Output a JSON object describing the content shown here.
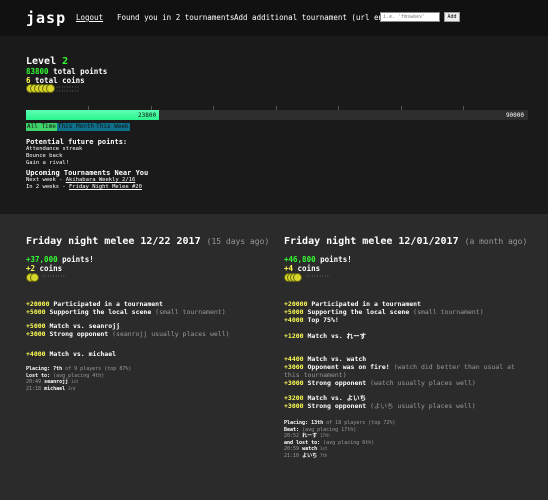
{
  "nav": {
    "logo": "jasp",
    "logout": "Logout",
    "found": "Found you in 2 tournaments",
    "add_label": "Add additional tournament (url ending)",
    "add_placeholder": "i.e. 'fmswkev'",
    "add_button": "Add"
  },
  "stats": {
    "level_label": "Level",
    "level_value": "2",
    "total_points": "83800 total points",
    "total_coins": "6 total coins",
    "coin_dots": ":::::::::\n:::::::::",
    "progress_current": "23800",
    "progress_max": "90000",
    "progress_fraction": 0.264,
    "tabs": [
      "All Time",
      "This Month",
      "This Week"
    ],
    "future_title": "Potential future points:",
    "future_items": [
      "Attendance streak",
      "Bounce back",
      "Gain a rival!"
    ],
    "upcoming_title": "Upcoming Tournaments Near You",
    "upcoming": [
      {
        "prefix": "Next week - ",
        "link": "Akihabara Weekly 2/16"
      },
      {
        "prefix": "In 2 weeks - ",
        "link": "Friday Night Melee #20"
      }
    ]
  },
  "tournaments": [
    {
      "title": "Friday night melee 12/22 2017",
      "ago": "(15 days ago)",
      "points": "+37,000 points!",
      "coins": "+2 coins",
      "coin_dots": ":::::::::",
      "groups": [
        [
          {
            "pts": "+20000",
            "desc": "Participated in a tournament",
            "note": ""
          },
          {
            "pts": "+5000",
            "desc": "Supporting the local scene",
            "note": "(small tournament)"
          }
        ],
        [
          {
            "pts": "+5000",
            "desc": "Match vs. seanrojj",
            "note": ""
          },
          {
            "pts": "+3000",
            "desc": "Strong opponent",
            "note": "(seanrojj usually places well)"
          }
        ],
        [
          {
            "pts": "+4000",
            "desc": "Match vs. michael",
            "note": ""
          }
        ]
      ],
      "placing": {
        "line1_bold": "Placing: 7th",
        "line1_rest": " of 9 players (top 87%)",
        "line2_bold": "Lost to:",
        "line2_rest": " (avg placing 4th)",
        "results": [
          {
            "score": "20:49",
            "name": "seanrojj",
            "tag": "1st"
          },
          {
            "score": "21:18",
            "name": "michael",
            "tag": "3rd"
          }
        ]
      }
    },
    {
      "title": "Friday night melee 12/01/2017",
      "ago": "(a month ago)",
      "points": "+46,800 points!",
      "coins": "+4 coins",
      "coin_dots": ":::::::::",
      "groups": [
        [
          {
            "pts": "+20000",
            "desc": "Participated in a tournament",
            "note": ""
          },
          {
            "pts": "+5000",
            "desc": "Supporting the local scene",
            "note": "(small tournament)"
          },
          {
            "pts": "+4000",
            "desc": "Top 75%!",
            "note": ""
          }
        ],
        [
          {
            "pts": "+1200",
            "desc": "Match vs. れーす",
            "note": ""
          }
        ],
        [
          {
            "pts": "+4400",
            "desc": "Match vs. watch",
            "note": ""
          },
          {
            "pts": "+3000",
            "desc": "Opponent was on fire!",
            "note": "(watch did better than usual at this tournament)"
          },
          {
            "pts": "+3000",
            "desc": "Strong opponent",
            "note": "(watch usually places well)"
          }
        ],
        [
          {
            "pts": "+3200",
            "desc": "Match vs. よいち",
            "note": ""
          },
          {
            "pts": "+3000",
            "desc": "Strong opponent",
            "note": "(よいち usually places well)"
          }
        ]
      ],
      "placing": {
        "line1_bold": "Placing: 13th",
        "line1_rest": " of 18 players (top 72%)",
        "line2_bold": "Beat:",
        "line2_rest": " (avg placing 17th)",
        "results": [
          {
            "score": "20:52",
            "name": "れーす",
            "tag": "17th"
          }
        ],
        "line3_bold": "and lost to:",
        "line3_rest": " (avg placing 6th)",
        "results2": [
          {
            "score": "20:59",
            "name": "watch",
            "tag": "1st"
          },
          {
            "score": "21:10",
            "name": "よいち",
            "tag": "7th"
          }
        ]
      }
    }
  ],
  "colors": {
    "accent_green": "#33ff33",
    "points_yellow": "#ffff55",
    "progress": "#2cf58f",
    "tab_active": "#3ed36a",
    "tab_inactive": "#0d6f8a"
  }
}
